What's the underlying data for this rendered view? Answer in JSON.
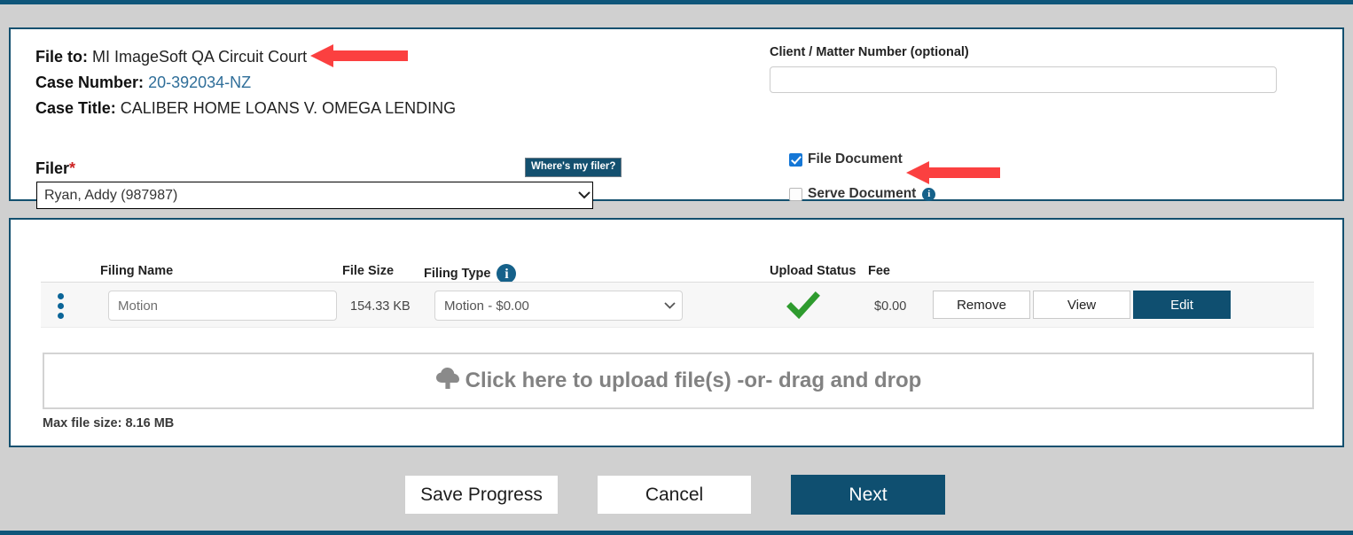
{
  "case_panel": {
    "file_to_label": "File to:",
    "file_to_value": "MI ImageSoft QA Circuit Court",
    "case_number_label": "Case Number:",
    "case_number_value": "20-392034-NZ",
    "case_title_label": "Case Title:",
    "case_title_value": "CALIBER HOME LOANS V. OMEGA LENDING",
    "filer_label": "Filer",
    "filer_required_mark": "*",
    "filer_selected": "Ryan, Addy (987987)",
    "filer_tooltip": "Where's my filer?",
    "client_matter_label": "Client / Matter Number (optional)",
    "client_matter_value": "",
    "client_matter_placeholder": "",
    "file_document_label": "File Document",
    "file_document_checked": true,
    "serve_document_label": "Serve Document",
    "serve_document_checked": false,
    "serve_info_icon": "info-icon",
    "caret_glyph": "⌄"
  },
  "filings_panel": {
    "columns": [
      "Filing Name",
      "File Size",
      "Filing Type",
      "Upload Status",
      "Fee"
    ],
    "filing_type_info_icon": "info-icon",
    "rows": [
      {
        "drag_handle": "drag-handle-icon",
        "filing_name": "Motion",
        "file_size": "154.33 KB",
        "filing_type": "Motion - $0.00",
        "upload_status_icon": "green-check-icon",
        "fee": "$0.00",
        "remove_label": "Remove",
        "view_label": "View",
        "edit_label": "Edit"
      }
    ],
    "dropzone_text": "Click here to upload file(s) -or- drag and drop",
    "dropzone_icon": "cloud-upload-icon",
    "max_file_size": "Max file size: 8.16 MB",
    "caret_glyph": "⌄"
  },
  "footer": {
    "save_label": "Save Progress",
    "cancel_label": "Cancel",
    "next_label": "Next"
  },
  "annotations": [
    {
      "name": "arrow-pointing-to-file-to",
      "direction": "left"
    },
    {
      "name": "arrow-pointing-to-serve-document",
      "direction": "left"
    }
  ],
  "colors": {
    "brand_dark": "#0f4f70",
    "panel_border": "#13506f",
    "page_bg": "#d0d0d0",
    "accent_link": "#2f6e99",
    "checkbox_blue": "#1577d6",
    "success_green": "#2e9b2e",
    "annotation_red": "#fb4040"
  }
}
